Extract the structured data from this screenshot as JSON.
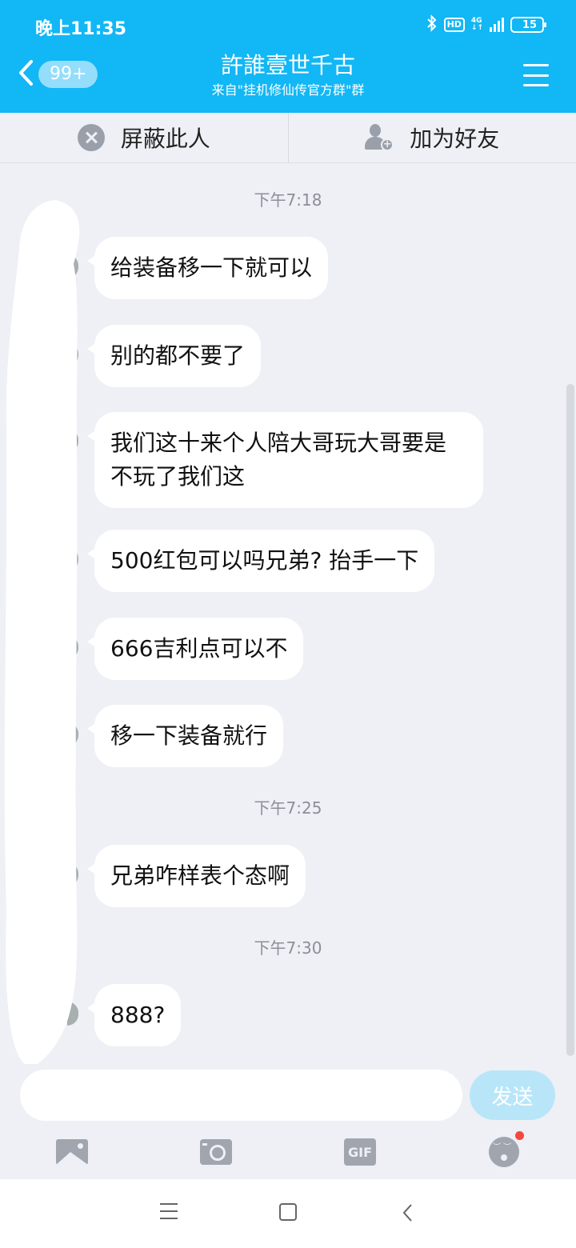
{
  "status_bar": {
    "time": "晚上11:35",
    "hd": "HD",
    "network": "4G",
    "battery": "15"
  },
  "header": {
    "back_badge": "99+",
    "title": "許誰壹世千古",
    "subtitle": "来自\"挂机修仙传官方群\"群"
  },
  "actions": {
    "block": "屏蔽此人",
    "add_friend": "加为好友"
  },
  "messages": [
    {
      "time": "下午7:18"
    },
    {
      "text": "给装备移一下就可以"
    },
    {
      "text": "别的都不要了"
    },
    {
      "text": "我们这十来个人陪大哥玩大哥要是不玩了我们这"
    },
    {
      "text": "500红包可以吗兄弟? 抬手一下"
    },
    {
      "text": "666吉利点可以不"
    },
    {
      "text": "移一下装备就行"
    },
    {
      "time": "下午7:25"
    },
    {
      "text": "兄弟咋样表个态啊"
    },
    {
      "time": "下午7:30"
    },
    {
      "text": "888?"
    }
  ],
  "composer": {
    "input_value": "",
    "send_label": "发送",
    "gif_label": "GIF"
  },
  "icons": [
    "back-icon",
    "menu-icon",
    "block-icon",
    "add-friend-icon",
    "image-icon",
    "camera-icon",
    "gif-icon",
    "emoji-icon"
  ],
  "colors": {
    "header": "#12b7f5",
    "background": "#eef0f5",
    "send_disabled": "#b8e6f8",
    "notification_dot": "#f5483b"
  }
}
